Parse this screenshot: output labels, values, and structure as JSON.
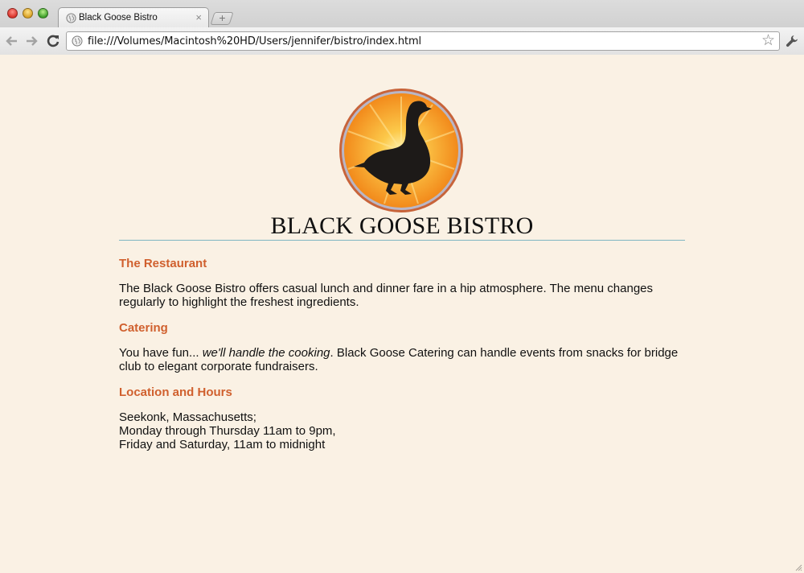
{
  "browser": {
    "tab_title": "Black Goose Bistro",
    "tab_close": "×",
    "new_tab_symbol": "+",
    "url": "file:///Volumes/Macintosh%20HD/Users/jennifer/bistro/index.html",
    "icons": {
      "back": "back-arrow-icon",
      "forward": "forward-arrow-icon",
      "reload": "reload-icon",
      "bookmark": "star-icon",
      "menu": "wrench-icon"
    }
  },
  "page": {
    "title": "BLACK GOOSE BISTRO",
    "sections": [
      {
        "heading": "The Restaurant",
        "body": "The Black Goose Bistro offers casual lunch and dinner fare in a hip atmosphere. The menu changes regularly to highlight the freshest ingredients."
      },
      {
        "heading": "Catering",
        "body_prefix": "You have fun... ",
        "body_emphasis": "we'll handle the cooking",
        "body_suffix": ". Black Goose Catering can handle events from snacks for bridge club to elegant corporate fundraisers."
      },
      {
        "heading": "Location and Hours",
        "lines": [
          "Seekonk, Massachusetts;",
          "Monday through Thursday 11am to 9pm,",
          "Friday and Saturday, 11am to midnight"
        ]
      }
    ]
  },
  "colors": {
    "page_background": "#faf1e4",
    "heading": "#d0602e",
    "rule": "#7fb6c2",
    "logo_orange": "#f7941d",
    "logo_ring": "#c8643a"
  }
}
